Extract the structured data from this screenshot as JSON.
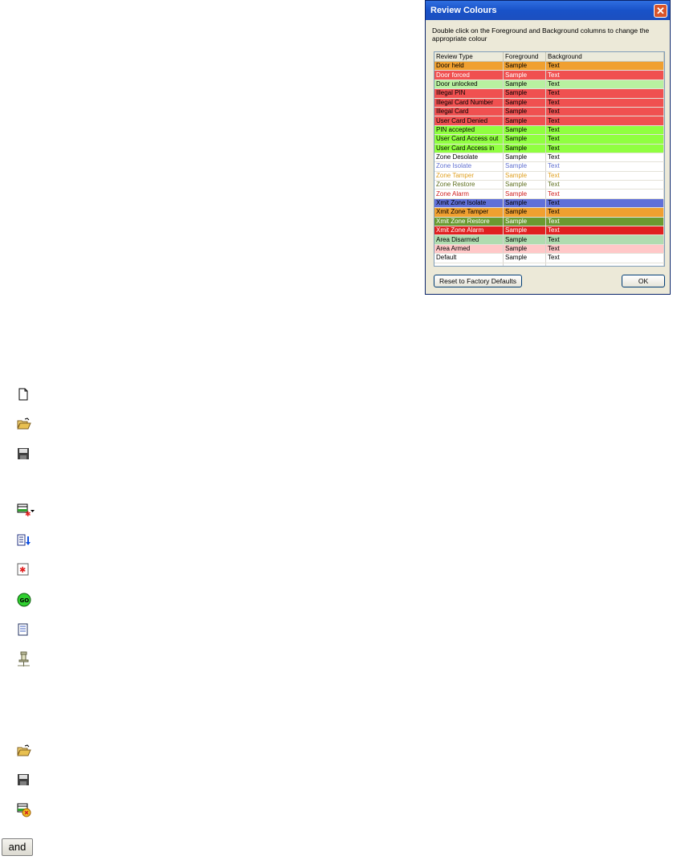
{
  "dialog": {
    "title": "Review Colours",
    "instruction": "Double click on the Foreground and Background columns to change the appropriate colour",
    "columns": [
      "Review Type",
      "Foreground",
      "Background"
    ],
    "rows": [
      {
        "type": "Door held",
        "fg": "Sample",
        "bg": "Text",
        "bg_color": "#f0a030",
        "fg_color": "#000000"
      },
      {
        "type": "Door forced",
        "fg": "Sample",
        "bg": "Text",
        "bg_color": "#f05050",
        "fg_color": "#ffffff"
      },
      {
        "type": "Door unlocked",
        "fg": "Sample",
        "bg": "Text",
        "bg_color": "#b8f0a0",
        "fg_color": "#000000"
      },
      {
        "type": "Illegal PIN",
        "fg": "Sample",
        "bg": "Text",
        "bg_color": "#f05050",
        "fg_color": "#000000"
      },
      {
        "type": "Illegal Card Number",
        "fg": "Sample",
        "bg": "Text",
        "bg_color": "#f05050",
        "fg_color": "#000000"
      },
      {
        "type": "Illegal Card",
        "fg": "Sample",
        "bg": "Text",
        "bg_color": "#f05050",
        "fg_color": "#000000"
      },
      {
        "type": "User Card Denied",
        "fg": "Sample",
        "bg": "Text",
        "bg_color": "#f05050",
        "fg_color": "#000000"
      },
      {
        "type": "PIN accepted",
        "fg": "Sample",
        "bg": "Text",
        "bg_color": "#90ff40",
        "fg_color": "#000000"
      },
      {
        "type": "User Card Access out",
        "fg": "Sample",
        "bg": "Text",
        "bg_color": "#90ff40",
        "fg_color": "#000000"
      },
      {
        "type": "User Card Access in",
        "fg": "Sample",
        "bg": "Text",
        "bg_color": "#90ff40",
        "fg_color": "#000000"
      },
      {
        "type": "Zone Desolate",
        "fg": "Sample",
        "bg": "Text",
        "bg_color": "#ffffff",
        "fg_color": "#000000"
      },
      {
        "type": "Zone Isolate",
        "fg": "Sample",
        "bg": "Text",
        "bg_color": "#ffffff",
        "fg_color": "#6070d0"
      },
      {
        "type": "Zone Tamper",
        "fg": "Sample",
        "bg": "Text",
        "bg_color": "#ffffff",
        "fg_color": "#e0a020"
      },
      {
        "type": "Zone Restore",
        "fg": "Sample",
        "bg": "Text",
        "bg_color": "#ffffff",
        "fg_color": "#607020"
      },
      {
        "type": "Zone Alarm",
        "fg": "Sample",
        "bg": "Text",
        "bg_color": "#ffffff",
        "fg_color": "#d02020"
      },
      {
        "type": "Xmit Zone Isolate",
        "fg": "Sample",
        "bg": "Text",
        "bg_color": "#6070d8",
        "fg_color": "#000000"
      },
      {
        "type": "Xmit Zone Tamper",
        "fg": "Sample",
        "bg": "Text",
        "bg_color": "#f0a030",
        "fg_color": "#000000"
      },
      {
        "type": "Xmit Zone Restore",
        "fg": "Sample",
        "bg": "Text",
        "bg_color": "#6a9a30",
        "fg_color": "#ffffff"
      },
      {
        "type": "Xmit Zone Alarm",
        "fg": "Sample",
        "bg": "Text",
        "bg_color": "#e02020",
        "fg_color": "#ffffff"
      },
      {
        "type": "Area Disarmed",
        "fg": "Sample",
        "bg": "Text",
        "bg_color": "#b0dcb0",
        "fg_color": "#000000"
      },
      {
        "type": "Area Armed",
        "fg": "Sample",
        "bg": "Text",
        "bg_color": "#ffc8c8",
        "fg_color": "#000000"
      },
      {
        "type": "Default",
        "fg": "Sample",
        "bg": "Text",
        "bg_color": "#ffffff",
        "fg_color": "#000000"
      }
    ],
    "empty_rows": 2,
    "reset_button": "Reset to Factory Defaults",
    "ok_button": "OK"
  },
  "icons": [
    {
      "name": "new-document-icon"
    },
    {
      "name": "open-folder-icon"
    },
    {
      "name": "save-floppy-icon"
    },
    {
      "name": "new-row-dropdown-icon"
    },
    {
      "name": "sort-list-icon"
    },
    {
      "name": "alarm-star-icon"
    },
    {
      "name": "go-icon"
    },
    {
      "name": "report-icon"
    },
    {
      "name": "pushpin-icon"
    },
    {
      "name": "open-folder-icon"
    },
    {
      "name": "save-floppy-icon"
    },
    {
      "name": "delete-row-icon"
    }
  ],
  "and_button": "and"
}
